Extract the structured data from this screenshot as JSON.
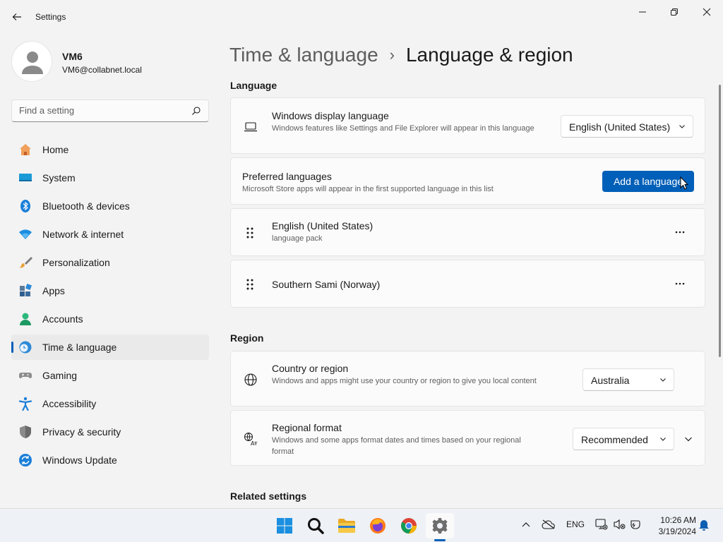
{
  "window": {
    "title": "Settings"
  },
  "profile": {
    "name": "VM6",
    "email": "VM6@collabnet.local"
  },
  "search": {
    "placeholder": "Find a setting"
  },
  "sidebar": {
    "items": [
      {
        "label": "Home",
        "icon": "home-icon"
      },
      {
        "label": "System",
        "icon": "system-icon"
      },
      {
        "label": "Bluetooth & devices",
        "icon": "bluetooth-icon"
      },
      {
        "label": "Network & internet",
        "icon": "wifi-icon"
      },
      {
        "label": "Personalization",
        "icon": "brush-icon"
      },
      {
        "label": "Apps",
        "icon": "apps-icon"
      },
      {
        "label": "Accounts",
        "icon": "accounts-icon"
      },
      {
        "label": "Time & language",
        "icon": "clock-globe-icon",
        "selected": true
      },
      {
        "label": "Gaming",
        "icon": "gamepad-icon"
      },
      {
        "label": "Accessibility",
        "icon": "accessibility-icon"
      },
      {
        "label": "Privacy & security",
        "icon": "shield-icon"
      },
      {
        "label": "Windows Update",
        "icon": "update-icon"
      }
    ]
  },
  "breadcrumb": {
    "parent": "Time & language",
    "separator": "›",
    "current": "Language & region"
  },
  "language_section": {
    "heading": "Language",
    "display_language": {
      "title": "Windows display language",
      "description": "Windows features like Settings and File Explorer will appear in this language",
      "value": "English (United States)"
    },
    "preferred": {
      "title": "Preferred languages",
      "description": "Microsoft Store apps will appear in the first supported language in this list",
      "button": "Add a language"
    },
    "languages": [
      {
        "name": "English (United States)",
        "detail": "language pack"
      },
      {
        "name": "Southern Sami (Norway)",
        "detail": ""
      }
    ],
    "more_label": "···"
  },
  "region_section": {
    "heading": "Region",
    "country": {
      "title": "Country or region",
      "description": "Windows and apps might use your country or region to give you local content",
      "value": "Australia"
    },
    "format": {
      "title": "Regional format",
      "description": "Windows and some apps format dates and times based on your regional format",
      "value": "Recommended"
    }
  },
  "related": {
    "heading": "Related settings"
  },
  "taskbar": {
    "apps": [
      "start-icon",
      "search-icon",
      "file-explorer-icon",
      "firefox-icon",
      "chrome-icon",
      "settings-icon"
    ],
    "tray": {
      "language": "ENG",
      "time": "10:26 AM",
      "date": "3/19/2024"
    }
  },
  "colors": {
    "accent": "#005fb8",
    "background": "#f3f3f3",
    "card": "#fbfbfb"
  }
}
